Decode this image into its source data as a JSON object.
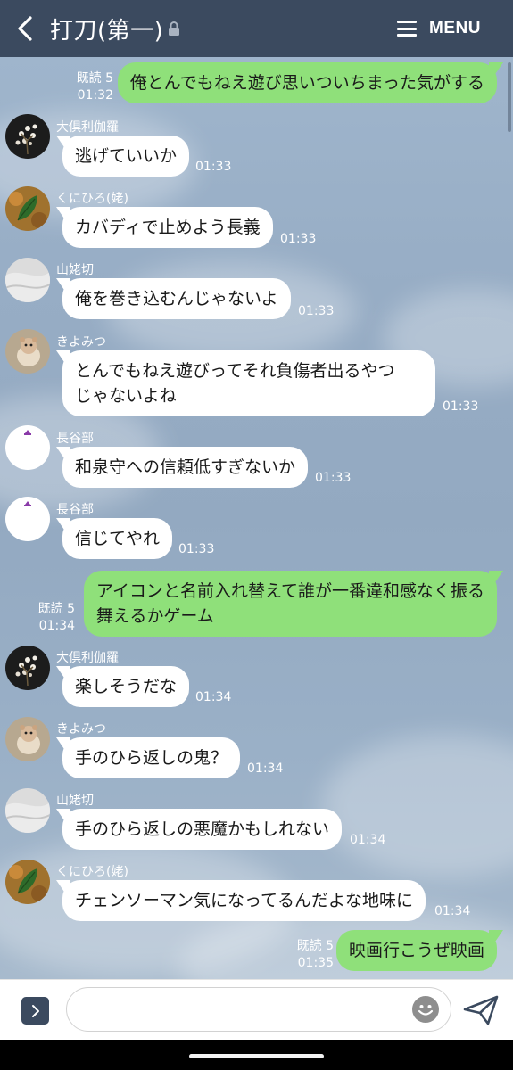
{
  "header": {
    "title": "打刀(第一)",
    "menu_label": "MENU",
    "bg_color": "#3b4a5f"
  },
  "messages": [
    {
      "type": "out",
      "read": "既読 5",
      "time": "01:32",
      "text": [
        "俺とんでもねえ遊び思いついちまった気がする"
      ]
    },
    {
      "type": "in",
      "sender": "大倶利伽羅",
      "avatar": "flowers",
      "time": "01:33",
      "text": [
        "逃げていいか"
      ]
    },
    {
      "type": "in",
      "sender": "くにひろ(姥)",
      "avatar": "leaf",
      "time": "01:33",
      "text": [
        "カバディで止めよう長義"
      ]
    },
    {
      "type": "in",
      "sender": "山姥切",
      "avatar": "white-cloth",
      "time": "01:33",
      "text": [
        "俺を巻き込むんじゃないよ"
      ]
    },
    {
      "type": "in",
      "sender": "きよみつ",
      "avatar": "hamster",
      "time": "01:33",
      "text": [
        "とんでもねえ遊びってそれ負傷者出るやつ",
        "じゃないよね"
      ]
    },
    {
      "type": "in",
      "sender": "長谷部",
      "avatar": "crest",
      "time": "01:33",
      "text": [
        "和泉守への信頼低すぎないか"
      ]
    },
    {
      "type": "in",
      "sender": "長谷部",
      "avatar": "crest",
      "time": "01:33",
      "text": [
        "信じてやれ"
      ]
    },
    {
      "type": "out",
      "read": "既読 5",
      "time": "01:34",
      "text": [
        "アイコンと名前入れ替えて誰が一番違和感なく振る",
        "舞えるかゲーム"
      ]
    },
    {
      "type": "in",
      "sender": "大倶利伽羅",
      "avatar": "flowers",
      "time": "01:34",
      "text": [
        "楽しそうだな"
      ]
    },
    {
      "type": "in",
      "sender": "きよみつ",
      "avatar": "hamster",
      "time": "01:34",
      "text": [
        "手のひら返しの鬼？"
      ]
    },
    {
      "type": "in",
      "sender": "山姥切",
      "avatar": "white-cloth",
      "time": "01:34",
      "text": [
        "手のひら返しの悪魔かもしれない"
      ]
    },
    {
      "type": "in",
      "sender": "くにひろ(姥)",
      "avatar": "leaf",
      "time": "01:34",
      "text": [
        "チェンソーマン気になってるんだよな地味に"
      ]
    },
    {
      "type": "out",
      "read": "既読 5",
      "time": "01:35",
      "text": [
        "映画行こうぜ映画"
      ]
    }
  ],
  "input": {
    "placeholder": "",
    "value": ""
  },
  "colors": {
    "outgoing_bubble": "#8fe07a",
    "incoming_bubble": "#ffffff",
    "chat_background": "#97adc5"
  }
}
